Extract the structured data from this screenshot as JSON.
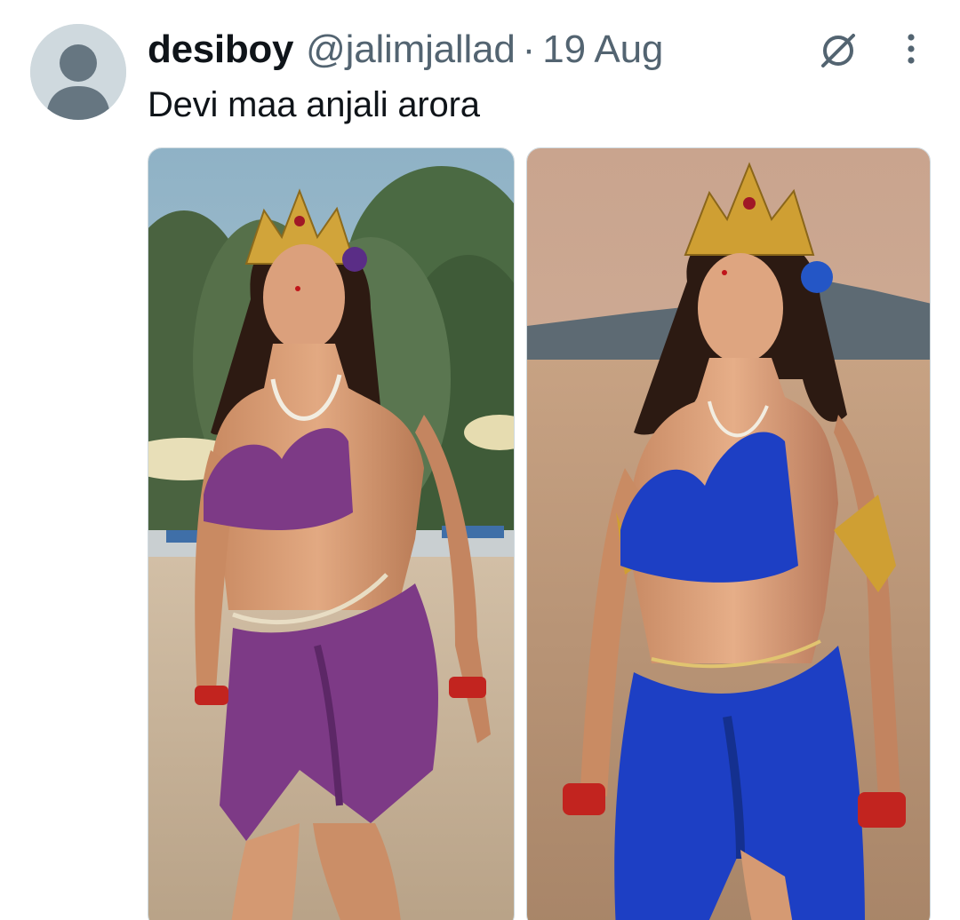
{
  "tweet": {
    "display_name": "desiboy",
    "handle": "@jalimjallad",
    "separator": "·",
    "date": "19 Aug",
    "text": "Devi maa anjali arora"
  },
  "icons": {
    "avatar": "default-avatar-icon",
    "grok": "grok-icon",
    "more": "more-options-icon"
  },
  "colors": {
    "text_primary": "#0f1419",
    "text_secondary": "#536471",
    "avatar_bg": "#cfd9de",
    "purple_outfit": "#7d3a86",
    "blue_outfit": "#1d3fc4"
  },
  "media": [
    {
      "scene": "beach-trees-purple-outfit"
    },
    {
      "scene": "sea-sunset-blue-outfit"
    }
  ]
}
